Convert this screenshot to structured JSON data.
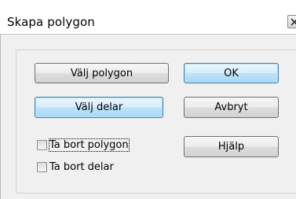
{
  "window": {
    "title": "Skapa polygon",
    "close_icon": "close-icon"
  },
  "buttons": {
    "select_polygon": "Välj polygon",
    "select_parts": "Välj delar",
    "ok": "OK",
    "cancel": "Avbryt",
    "help": "Hjälp"
  },
  "checkboxes": {
    "remove_polygon": {
      "label": "Ta bort polygon",
      "checked": false
    },
    "remove_parts": {
      "label": "Ta bort delar",
      "checked": false
    }
  }
}
